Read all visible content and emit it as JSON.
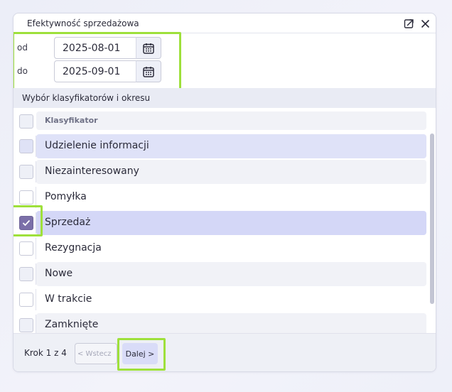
{
  "window": {
    "title": "Efektywność sprzedażowa"
  },
  "dates": {
    "from_label": "od",
    "from_value": "2025-08-01",
    "to_label": "do",
    "to_value": "2025-09-01"
  },
  "section_title": "Wybór klasyfikatorów i okresu",
  "table": {
    "header": "Klasyfikator",
    "items": [
      {
        "label": "Udzielenie informacji",
        "checked": false
      },
      {
        "label": "Niezainteresowany",
        "checked": false
      },
      {
        "label": "Pomyłka",
        "checked": false
      },
      {
        "label": "Sprzedaż",
        "checked": true
      },
      {
        "label": "Rezygnacja",
        "checked": false
      },
      {
        "label": "Nowe",
        "checked": false
      },
      {
        "label": "W trakcie",
        "checked": false
      },
      {
        "label": "Zamknięte",
        "checked": false
      }
    ]
  },
  "footer": {
    "step": "Krok 1 z 4",
    "back_label": "< Wstecz",
    "next_label": "Dalej >"
  },
  "colors": {
    "accent_highlight": "#9ee03b",
    "checkbox_checked": "#7b6fa8",
    "selected_row": "#d4d7f7"
  }
}
